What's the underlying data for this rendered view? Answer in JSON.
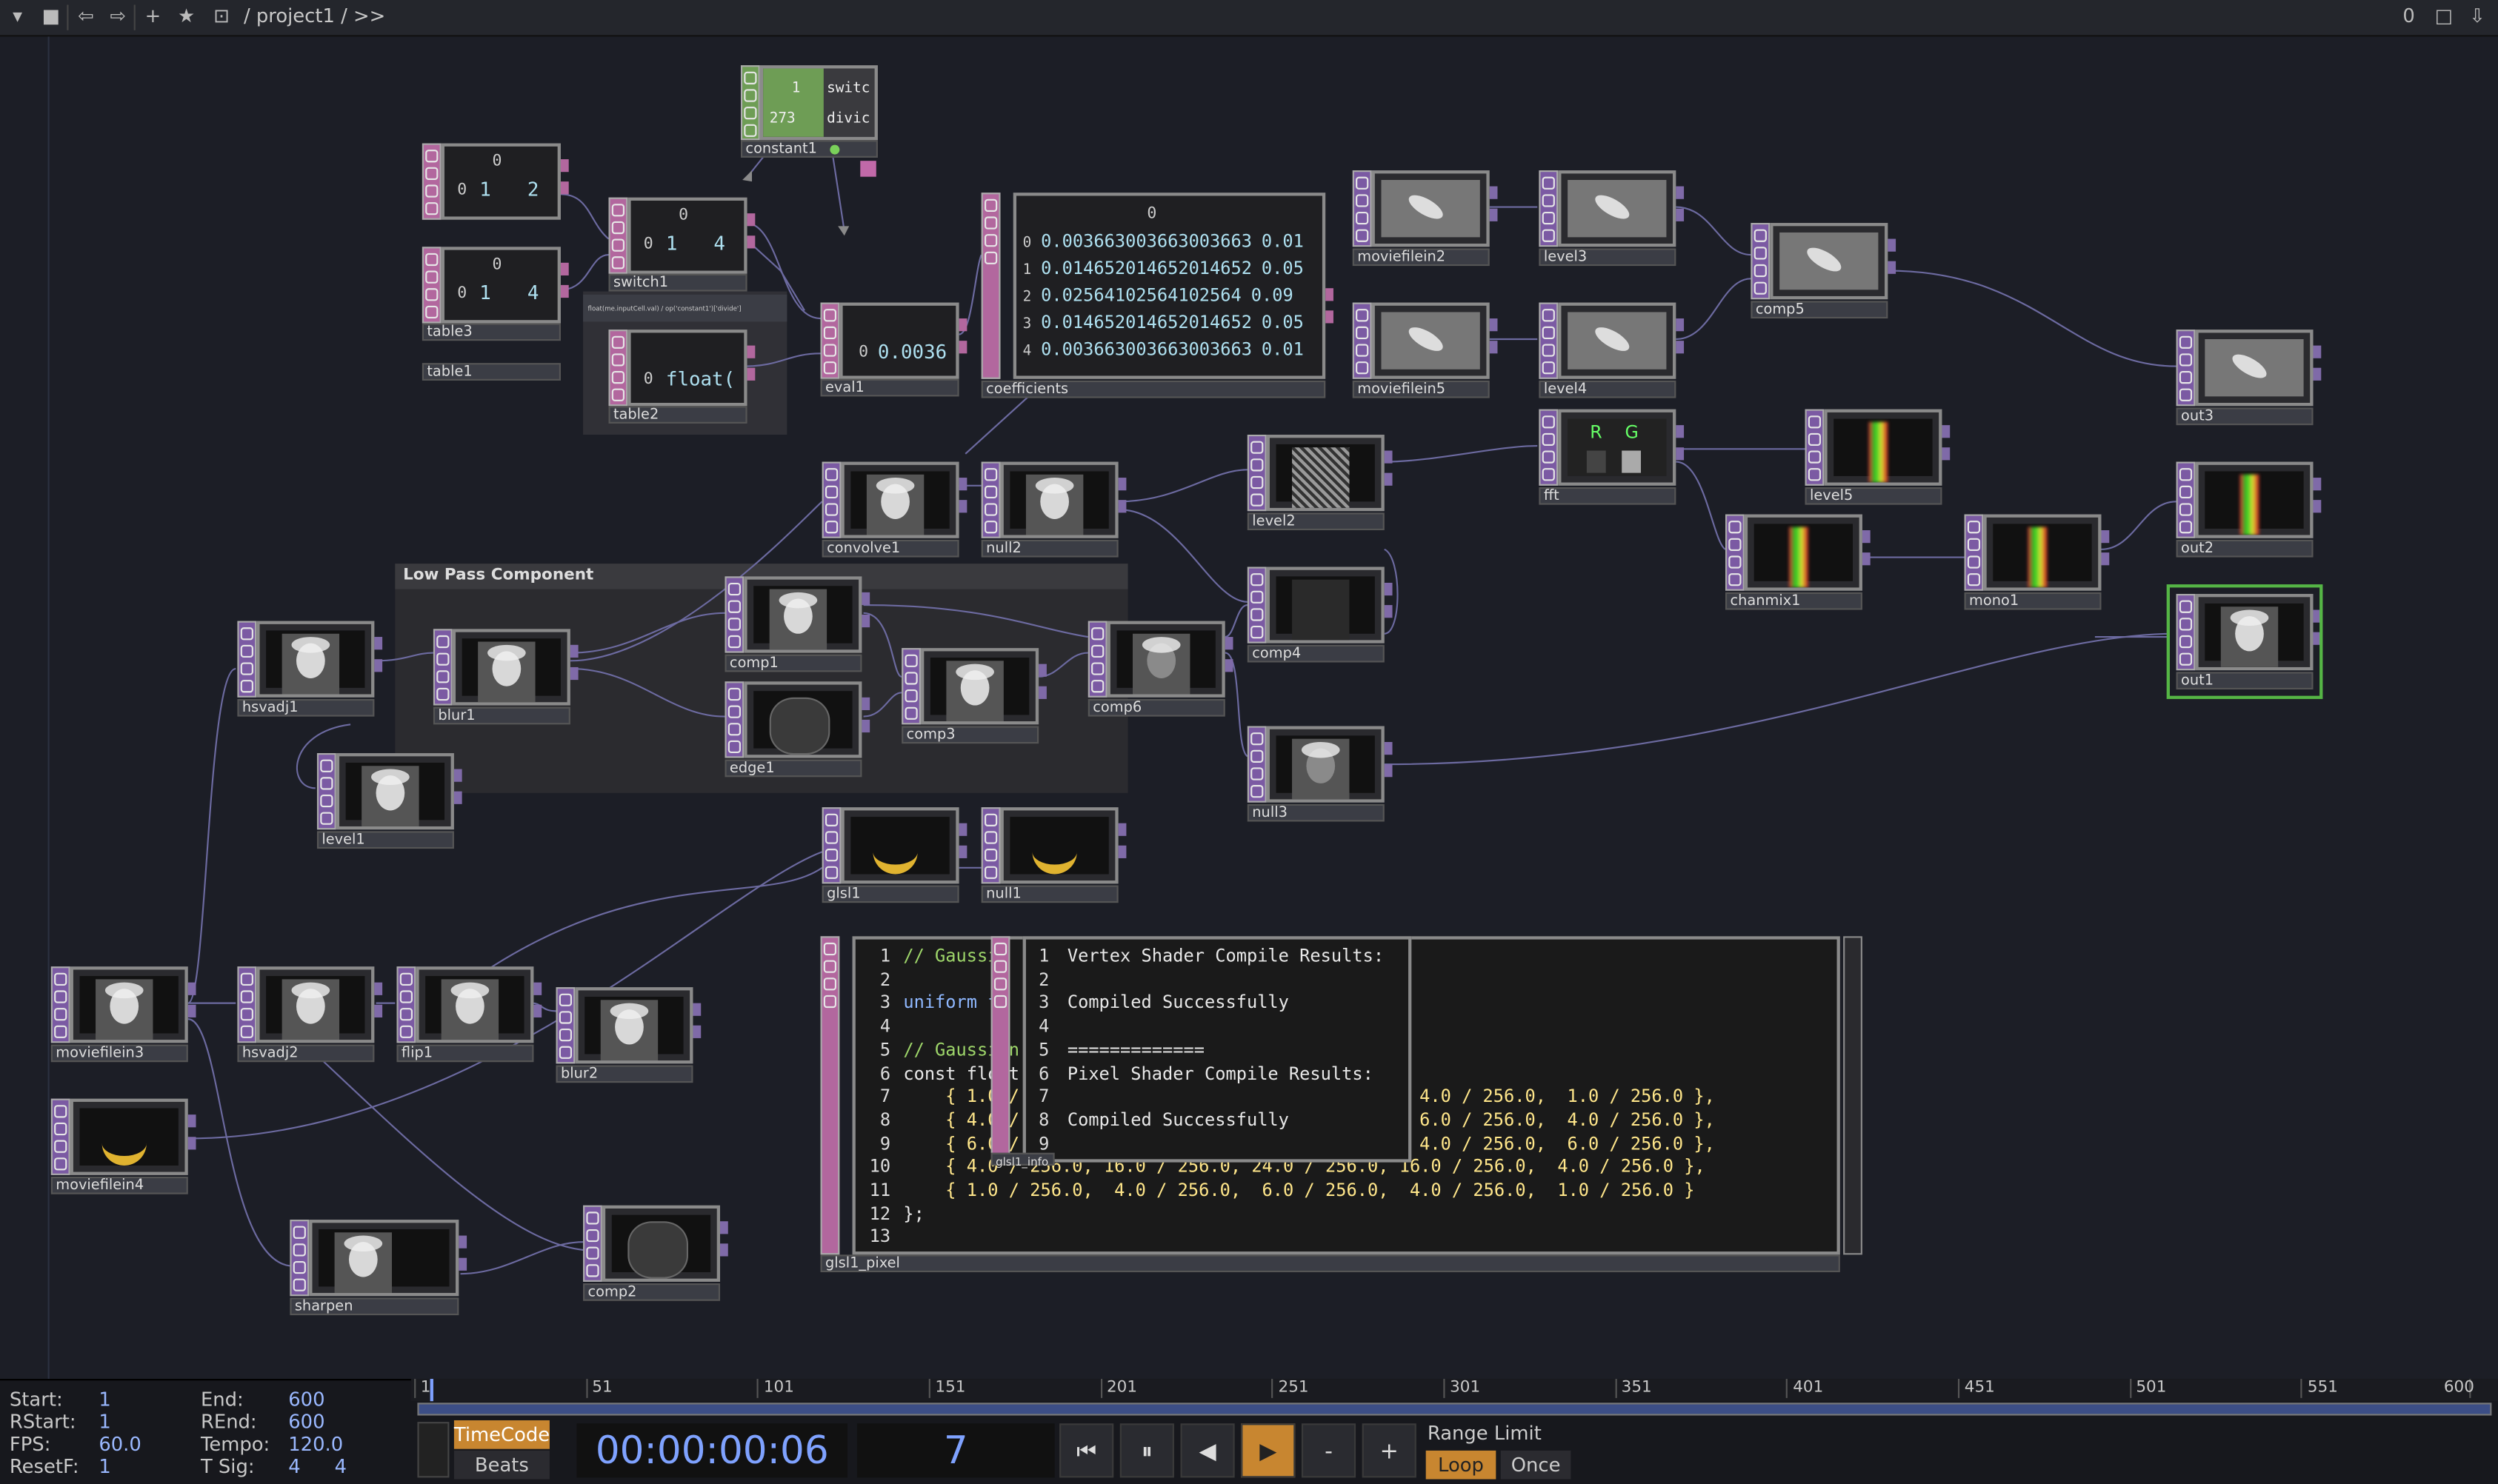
{
  "topbar": {
    "path": "/ project1 / >>",
    "right_value": "0"
  },
  "component": {
    "title": "Low Pass Component"
  },
  "nodes": {
    "table1": {
      "label": "table1",
      "header": "0",
      "row_index": "0",
      "v1": "1",
      "v2": "2"
    },
    "table3": {
      "label": "table3",
      "header": "0",
      "row_index": "0",
      "v1": "1",
      "v2": "4"
    },
    "switch1": {
      "label": "switch1",
      "header": "0",
      "row_index": "0",
      "v1": "1",
      "v2": "4"
    },
    "table2": {
      "label": "table2",
      "row_index": "0",
      "v1": "float("
    },
    "eval1": {
      "label": "eval1",
      "row_index": "0",
      "v1": "0.0036"
    },
    "constant1": {
      "label": "constant1",
      "r1_num": "1",
      "r1_txt": "switc",
      "r2_num": "273",
      "r2_txt": "divic"
    },
    "coefficients": {
      "label": "coefficients",
      "header": "0",
      "rows": [
        {
          "i": "0",
          "v": "0.003663003663003663",
          "c": "0.01"
        },
        {
          "i": "1",
          "v": "0.014652014652014652",
          "c": "0.05"
        },
        {
          "i": "2",
          "v": "0.02564102564102564",
          "c": "0.09"
        },
        {
          "i": "3",
          "v": "0.014652014652014652",
          "c": "0.05"
        },
        {
          "i": "4",
          "v": "0.003663003663003663",
          "c": "0.01"
        }
      ]
    },
    "tooltip": "float(me.inputCell.val) / op('constant1')['divide']",
    "moviefilein2": "moviefilein2",
    "moviefilein5": "moviefilein5",
    "level3": "level3",
    "level4": "level4",
    "comp5": "comp5",
    "out3": "out3",
    "fft": {
      "label": "fft",
      "r": "R",
      "g": "G"
    },
    "level5": "level5",
    "out2": "out2",
    "chanmix1": "chanmix1",
    "mono1": "mono1",
    "out1": "out1",
    "convolve1": "convolve1",
    "null2": "null2",
    "level2": "level2",
    "comp4": "comp4",
    "null3": "null3",
    "hsvadj1": "hsvadj1",
    "blur1": "blur1",
    "comp1": "comp1",
    "edge1": "edge1",
    "comp3": "comp3",
    "comp6": "comp6",
    "level1": "level1",
    "glsl1": "glsl1",
    "null1": "null1",
    "moviefilein3": "moviefilein3",
    "hsvadj2": "hsvadj2",
    "flip1": "flip1",
    "blur2": "blur2",
    "moviefilein4": "moviefilein4",
    "sharpen": "sharpen",
    "comp2": "comp2",
    "glsl1_pixel": "glsl1_pixel",
    "glsl1_info": "glsl1_info"
  },
  "code": {
    "lines": [
      {
        "n": "1",
        "t": "// Gaussi"
      },
      {
        "n": "2",
        "t": ""
      },
      {
        "n": "3",
        "t": "uniform fl"
      },
      {
        "n": "4",
        "t": ""
      },
      {
        "n": "5",
        "t": "// Gaussian"
      },
      {
        "n": "6",
        "t": "const float"
      },
      {
        "n": "7",
        "t": "    { 1.0 /"
      },
      {
        "n": "8",
        "t": "    { 4.0 /"
      },
      {
        "n": "9",
        "t": "    { 6.0 / 256.0, 24.0 / 256.0, 36.0 / 256.0,"
      },
      {
        "n": "10",
        "t": "    { 4.0 / 256.0, 16.0 / 256.0, 24.0 / 256.0, 16.0 / 256.0,  4.0 / 256.0 },"
      },
      {
        "n": "11",
        "t": "    { 1.0 / 256.0,  4.0 / 256.0,  6.0 / 256.0,  4.0 / 256.0,  1.0 / 256.0 }"
      },
      {
        "n": "12",
        "t": "};"
      },
      {
        "n": "13",
        "t": ""
      }
    ],
    "right_tails": [
      {
        "row": "7",
        "t": "4.0 / 256.0,  1.0 / 256.0 },"
      },
      {
        "row": "8",
        "t": "6.0 / 256.0,  4.0 / 256.0 },"
      },
      {
        "row": "9",
        "t": "4.0 / 256.0,  6.0 / 256.0 },"
      }
    ]
  },
  "info": {
    "lines": [
      {
        "n": "1",
        "t": "Vertex Shader Compile Results:"
      },
      {
        "n": "2",
        "t": ""
      },
      {
        "n": "3",
        "t": "Compiled Successfully"
      },
      {
        "n": "4",
        "t": ""
      },
      {
        "n": "5",
        "t": "============="
      },
      {
        "n": "6",
        "t": "Pixel Shader Compile Results:"
      },
      {
        "n": "7",
        "t": ""
      },
      {
        "n": "8",
        "t": "Compiled Successfully"
      },
      {
        "n": "9",
        "t": ""
      }
    ]
  },
  "timeline": {
    "start_label": "Start:",
    "start": "1",
    "end_label": "End:",
    "end": "600",
    "rstart_label": "RStart:",
    "rstart": "1",
    "rend_label": "REnd:",
    "rend": "600",
    "fps_label": "FPS:",
    "fps": "60.0",
    "tempo_label": "Tempo:",
    "tempo": "120.0",
    "resetf_label": "ResetF:",
    "resetf": "1",
    "tsig_label": "T Sig:",
    "tsig_a": "4",
    "tsig_b": "4",
    "ticks": [
      "1",
      "51",
      "101",
      "151",
      "201",
      "251",
      "301",
      "351",
      "401",
      "451",
      "501",
      "551",
      "600"
    ],
    "timecode_label": "TimeCode",
    "beats_label": "Beats",
    "timecode": "00:00:00:06",
    "frame": "7",
    "range_limit_label": "Range Limit",
    "loop_label": "Loop",
    "once_label": "Once",
    "minus": "-",
    "plus": "+"
  },
  "colors": {
    "top_strip": "#7b5aa3",
    "chop_strip": "#a8639c",
    "dat_strip": "#b2679e",
    "accent_blue": "#7fa2ff",
    "play_orange": "#c88630",
    "selected_green": "#55b545"
  }
}
